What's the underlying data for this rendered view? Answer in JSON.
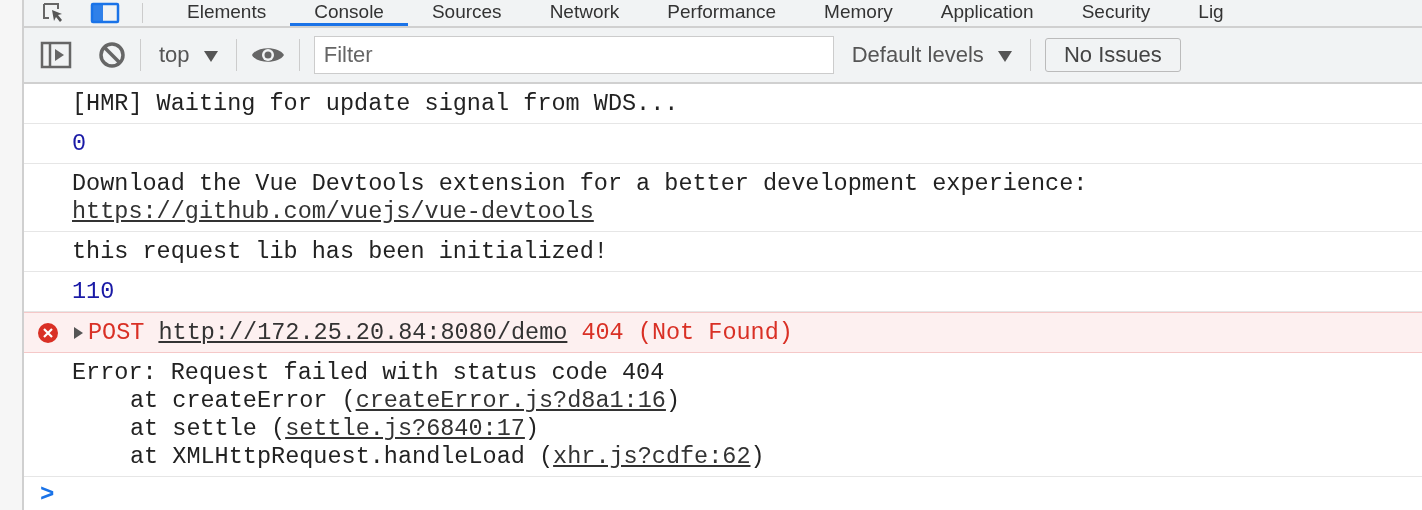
{
  "tabs": [
    {
      "label": "Elements",
      "selected": false
    },
    {
      "label": "Console",
      "selected": true
    },
    {
      "label": "Sources",
      "selected": false
    },
    {
      "label": "Network",
      "selected": false
    },
    {
      "label": "Performance",
      "selected": false
    },
    {
      "label": "Memory",
      "selected": false
    },
    {
      "label": "Application",
      "selected": false
    },
    {
      "label": "Security",
      "selected": false
    },
    {
      "label": "Lig",
      "selected": false
    }
  ],
  "toolbar": {
    "context": "top",
    "filter": {
      "placeholder": "Filter"
    },
    "levels": "Default levels",
    "issues": "No Issues"
  },
  "messages": [
    {
      "kind": "log",
      "text": "[HMR] Waiting for update signal from WDS..."
    },
    {
      "kind": "number",
      "text": "0"
    },
    {
      "kind": "log",
      "text": "Download the Vue Devtools extension for a better development experience:",
      "link": "https://github.com/vuejs/vue-devtools"
    },
    {
      "kind": "log",
      "text": "this request lib has been initialized!"
    },
    {
      "kind": "number",
      "text": "110"
    },
    {
      "kind": "error",
      "method": "POST",
      "url": "http://172.25.20.84:8080/demo",
      "status": "404 (Not Found)",
      "expanded": false
    },
    {
      "kind": "log",
      "text": "Error: Request failed with status code 404",
      "frames": [
        {
          "prefix": "at createError (",
          "link": "createError.js?d8a1:16",
          "suffix": ")"
        },
        {
          "prefix": "at settle (",
          "link": "settle.js?6840:17",
          "suffix": ")"
        },
        {
          "prefix": "at XMLHttpRequest.handleLoad (",
          "link": "xhr.js?cdfe:62",
          "suffix": ")"
        }
      ]
    }
  ],
  "prompt": ">"
}
